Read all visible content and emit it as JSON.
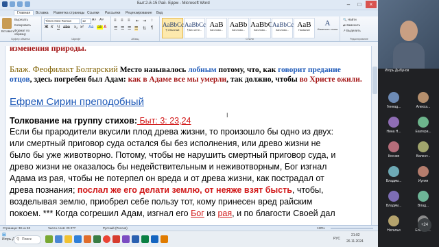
{
  "window": {
    "title": "Быт.2-й-15 Рай- Едем - Microsoft Word"
  },
  "tabs": [
    "Главная",
    "Вставка",
    "Разметка страницы",
    "Ссылки",
    "Рассылки",
    "Рецензирование",
    "Вид"
  ],
  "ribbon": {
    "paste_label": "Вставить",
    "clipboard_items": [
      "Вырезать",
      "Копировать",
      "Формат по образцу"
    ],
    "font_name": "Times New Roman",
    "font_size": "12",
    "styles": [
      {
        "sample": "AaBbCcDc",
        "name": "¶ Обычный"
      },
      {
        "sample": "AaBbCcDc",
        "name": "¶ Без инте..."
      },
      {
        "sample": "AaB",
        "name": "Заголово..."
      },
      {
        "sample": "AaBb",
        "name": "Заголово..."
      },
      {
        "sample": "AaBbC",
        "name": "Заголово..."
      },
      {
        "sample": "AaBbCcD",
        "name": "Заголово..."
      },
      {
        "sample": "AaB",
        "name": "Название"
      }
    ],
    "change_styles": "Изменить стили",
    "editing_items": [
      "Найти",
      "Заменить",
      "Выделить"
    ],
    "groups": [
      "Буфер обмена",
      "Шрифт",
      "Абзац",
      "Стили",
      "Редактирование"
    ]
  },
  "document": {
    "line1": "изменения природы.",
    "p2": {
      "author": "Блаж. Феофилакт Болгарский",
      "t1": " Место называлось ",
      "t2": "лобным",
      "t3": " потому, что, как ",
      "t4": "говорит предание",
      "t5": "отцов",
      "t6": ", здесь погребен был Адам: ",
      "t7": "как в Адаме все мы умерли",
      "t8": ", так должно, чтобы ",
      "t9": "во Христе ожили."
    },
    "heading": "Ефрем Сирин преподобный",
    "sub": {
      "label": "Толкование на группу стихов",
      "colon": ":",
      "ref": " Быт: 3: 23,24"
    },
    "body": [
      "Если бы прародители вкусили плод древа жизни, то произошло бы одно из двух:",
      "или смертный приговор суда остался бы без исполнения, или древо жизни не",
      "было бы уже животворно. Потому, чтобы не нарушить смертный приговор суда, и",
      "древо жизни не оказалось бы недействительным и неживотворным, Бог изгнал",
      "Адама из рая, чтобы не потерпел он вреда и от древа жизни, как пострадал от"
    ],
    "line_quote": {
      "pre": "древа познания; ",
      "quote": "послал же его делати землю, от нeяже взят бысть",
      "post": ", чтобы,"
    },
    "line_last": "возделывая землю, приобрел себе пользу тот, кому принесен вред райским",
    "line_partial": {
      "t1": "покоем. *** Когда согрешил Адам, изгнал его ",
      "t2": "Бог",
      "t3": " из ",
      "t4": "рая",
      "t5": ", и по благости Своей дал"
    }
  },
  "status": {
    "page": "Страница: 38 из 53",
    "words": "Число слов: 20 077",
    "lang": "Русский (Россия)",
    "zoom": "120%"
  },
  "taskbar": {
    "user": "Игорь Дыбунов",
    "search": "Поиск",
    "lang": "РУС",
    "time": "21:02",
    "date": "26.11.2024"
  },
  "meeting": {
    "self_name": "Игорь Дыбунов",
    "participants": [
      "Геннад...",
      "Алекса...",
      "Нина Н...",
      "Екатери...",
      "Ксения",
      "Валент...",
      "Владим...",
      "Иулия",
      "Владим...",
      "Влад...",
      "Наталья",
      "Елена З..."
    ],
    "more_count": "+24"
  },
  "colors": {
    "heading_blue": "#1f5ab8",
    "dark_red": "#a31515",
    "red": "#d11717"
  }
}
